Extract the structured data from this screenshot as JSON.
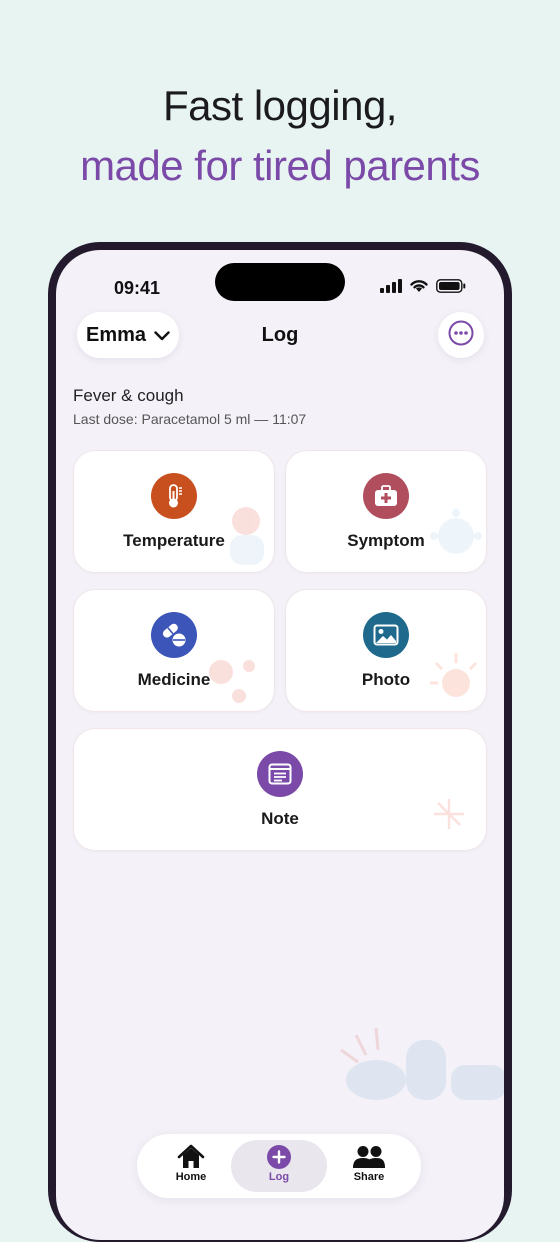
{
  "headline": {
    "line1": "Fast logging,",
    "line2": "made for tired parents"
  },
  "status_bar": {
    "time": "09:41"
  },
  "header": {
    "child_name": "Emma",
    "title": "Log"
  },
  "episode": {
    "name": "Fever & cough",
    "last_dose": "Last dose: Paracetamol 5 ml — 11:07"
  },
  "cards": {
    "temperature": {
      "label": "Temperature",
      "color": "#c8501f",
      "icon": "thermometer-icon"
    },
    "symptom": {
      "label": "Symptom",
      "color": "#b04e5e",
      "icon": "first-aid-kit-icon"
    },
    "medicine": {
      "label": "Medicine",
      "color": "#3b55b8",
      "icon": "pills-icon"
    },
    "photo": {
      "label": "Photo",
      "color": "#1f6a8c",
      "icon": "image-icon"
    },
    "note": {
      "label": "Note",
      "color": "#7b4aa8",
      "icon": "note-icon"
    }
  },
  "nav": {
    "home": "Home",
    "log": "Log",
    "share": "Share",
    "accent": "#7b4aa8"
  }
}
